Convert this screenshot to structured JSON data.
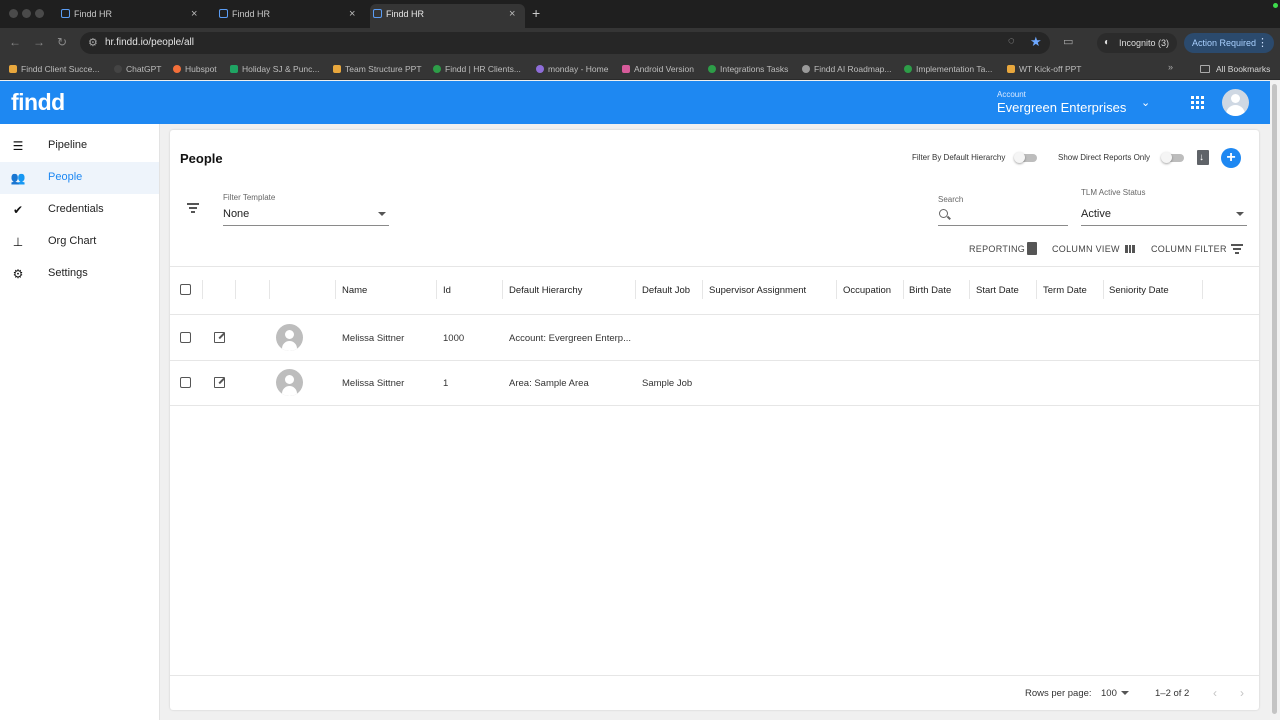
{
  "browser": {
    "tabs": [
      {
        "title": "Findd HR",
        "close": "×"
      },
      {
        "title": "Findd HR",
        "close": "×"
      },
      {
        "title": "Findd HR",
        "close": "×"
      }
    ],
    "new_tab": "+",
    "url": "hr.findd.io/people/all",
    "incognito": "Incognito (3)",
    "action_required": "Action Required",
    "bookmarks": [
      "Findd Client Succe...",
      "ChatGPT",
      "Hubspot",
      "Holiday SJ & Punc...",
      "Team Structure PPT",
      "Findd | HR Clients...",
      "monday - Home",
      "Android Version",
      "Integrations Tasks",
      "Findd AI Roadmap...",
      "Implementation Ta...",
      "WT Kick-off PPT"
    ],
    "bookmarks_more": "»",
    "all_bookmarks": "All Bookmarks"
  },
  "header": {
    "logo": "findd",
    "account_label": "Account",
    "account_name": "Evergreen Enterprises"
  },
  "sidebar": {
    "items": [
      {
        "label": "Pipeline",
        "icon": "list-icon"
      },
      {
        "label": "People",
        "icon": "people-icon"
      },
      {
        "label": "Credentials",
        "icon": "check-circle-icon"
      },
      {
        "label": "Org Chart",
        "icon": "org-chart-icon"
      },
      {
        "label": "Settings",
        "icon": "gears-icon"
      }
    ],
    "active": "People"
  },
  "main": {
    "title": "People",
    "filter_default_hierarchy": "Filter By Default Hierarchy",
    "show_direct_reports": "Show Direct Reports Only",
    "filter_template_label": "Filter Template",
    "filter_template_value": "None",
    "search_label": "Search",
    "search_value": "",
    "tlm_status_label": "TLM Active Status",
    "tlm_status_value": "Active",
    "actions": {
      "reporting": "REPORTING",
      "column_view": "COLUMN VIEW",
      "column_filter": "COLUMN FILTER"
    },
    "columns": [
      "Name",
      "Id",
      "Default Hierarchy",
      "Default Job",
      "Supervisor Assignment",
      "Occupation",
      "Birth Date",
      "Start Date",
      "Term Date",
      "Seniority Date"
    ],
    "rows": [
      {
        "name": "Melissa Sittner",
        "id": "1000",
        "hierarchy": "Account: Evergreen Enterp...",
        "job": ""
      },
      {
        "name": "Melissa Sittner",
        "id": "1",
        "hierarchy": "Area: Sample Area",
        "job": "Sample Job"
      }
    ],
    "footer": {
      "rows_per_page_label": "Rows per page:",
      "rows_per_page_value": "100",
      "range": "1–2 of 2"
    }
  },
  "colors": {
    "brand_blue": "#1e88f2",
    "active_bg": "#eef4fb"
  }
}
